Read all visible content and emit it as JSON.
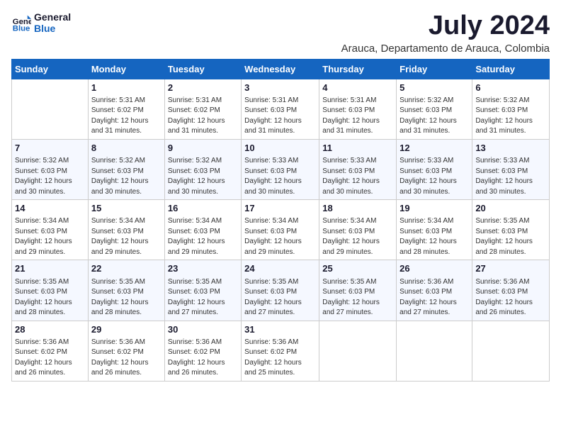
{
  "header": {
    "logo_line1": "General",
    "logo_line2": "Blue",
    "month_year": "July 2024",
    "location": "Arauca, Departamento de Arauca, Colombia"
  },
  "days_of_week": [
    "Sunday",
    "Monday",
    "Tuesday",
    "Wednesday",
    "Thursday",
    "Friday",
    "Saturday"
  ],
  "weeks": [
    [
      {
        "day": "",
        "info": ""
      },
      {
        "day": "1",
        "info": "Sunrise: 5:31 AM\nSunset: 6:02 PM\nDaylight: 12 hours\nand 31 minutes."
      },
      {
        "day": "2",
        "info": "Sunrise: 5:31 AM\nSunset: 6:02 PM\nDaylight: 12 hours\nand 31 minutes."
      },
      {
        "day": "3",
        "info": "Sunrise: 5:31 AM\nSunset: 6:03 PM\nDaylight: 12 hours\nand 31 minutes."
      },
      {
        "day": "4",
        "info": "Sunrise: 5:31 AM\nSunset: 6:03 PM\nDaylight: 12 hours\nand 31 minutes."
      },
      {
        "day": "5",
        "info": "Sunrise: 5:32 AM\nSunset: 6:03 PM\nDaylight: 12 hours\nand 31 minutes."
      },
      {
        "day": "6",
        "info": "Sunrise: 5:32 AM\nSunset: 6:03 PM\nDaylight: 12 hours\nand 31 minutes."
      }
    ],
    [
      {
        "day": "7",
        "info": "Sunrise: 5:32 AM\nSunset: 6:03 PM\nDaylight: 12 hours\nand 30 minutes."
      },
      {
        "day": "8",
        "info": "Sunrise: 5:32 AM\nSunset: 6:03 PM\nDaylight: 12 hours\nand 30 minutes."
      },
      {
        "day": "9",
        "info": "Sunrise: 5:32 AM\nSunset: 6:03 PM\nDaylight: 12 hours\nand 30 minutes."
      },
      {
        "day": "10",
        "info": "Sunrise: 5:33 AM\nSunset: 6:03 PM\nDaylight: 12 hours\nand 30 minutes."
      },
      {
        "day": "11",
        "info": "Sunrise: 5:33 AM\nSunset: 6:03 PM\nDaylight: 12 hours\nand 30 minutes."
      },
      {
        "day": "12",
        "info": "Sunrise: 5:33 AM\nSunset: 6:03 PM\nDaylight: 12 hours\nand 30 minutes."
      },
      {
        "day": "13",
        "info": "Sunrise: 5:33 AM\nSunset: 6:03 PM\nDaylight: 12 hours\nand 30 minutes."
      }
    ],
    [
      {
        "day": "14",
        "info": "Sunrise: 5:34 AM\nSunset: 6:03 PM\nDaylight: 12 hours\nand 29 minutes."
      },
      {
        "day": "15",
        "info": "Sunrise: 5:34 AM\nSunset: 6:03 PM\nDaylight: 12 hours\nand 29 minutes."
      },
      {
        "day": "16",
        "info": "Sunrise: 5:34 AM\nSunset: 6:03 PM\nDaylight: 12 hours\nand 29 minutes."
      },
      {
        "day": "17",
        "info": "Sunrise: 5:34 AM\nSunset: 6:03 PM\nDaylight: 12 hours\nand 29 minutes."
      },
      {
        "day": "18",
        "info": "Sunrise: 5:34 AM\nSunset: 6:03 PM\nDaylight: 12 hours\nand 29 minutes."
      },
      {
        "day": "19",
        "info": "Sunrise: 5:34 AM\nSunset: 6:03 PM\nDaylight: 12 hours\nand 28 minutes."
      },
      {
        "day": "20",
        "info": "Sunrise: 5:35 AM\nSunset: 6:03 PM\nDaylight: 12 hours\nand 28 minutes."
      }
    ],
    [
      {
        "day": "21",
        "info": "Sunrise: 5:35 AM\nSunset: 6:03 PM\nDaylight: 12 hours\nand 28 minutes."
      },
      {
        "day": "22",
        "info": "Sunrise: 5:35 AM\nSunset: 6:03 PM\nDaylight: 12 hours\nand 28 minutes."
      },
      {
        "day": "23",
        "info": "Sunrise: 5:35 AM\nSunset: 6:03 PM\nDaylight: 12 hours\nand 27 minutes."
      },
      {
        "day": "24",
        "info": "Sunrise: 5:35 AM\nSunset: 6:03 PM\nDaylight: 12 hours\nand 27 minutes."
      },
      {
        "day": "25",
        "info": "Sunrise: 5:35 AM\nSunset: 6:03 PM\nDaylight: 12 hours\nand 27 minutes."
      },
      {
        "day": "26",
        "info": "Sunrise: 5:36 AM\nSunset: 6:03 PM\nDaylight: 12 hours\nand 27 minutes."
      },
      {
        "day": "27",
        "info": "Sunrise: 5:36 AM\nSunset: 6:03 PM\nDaylight: 12 hours\nand 26 minutes."
      }
    ],
    [
      {
        "day": "28",
        "info": "Sunrise: 5:36 AM\nSunset: 6:02 PM\nDaylight: 12 hours\nand 26 minutes."
      },
      {
        "day": "29",
        "info": "Sunrise: 5:36 AM\nSunset: 6:02 PM\nDaylight: 12 hours\nand 26 minutes."
      },
      {
        "day": "30",
        "info": "Sunrise: 5:36 AM\nSunset: 6:02 PM\nDaylight: 12 hours\nand 26 minutes."
      },
      {
        "day": "31",
        "info": "Sunrise: 5:36 AM\nSunset: 6:02 PM\nDaylight: 12 hours\nand 25 minutes."
      },
      {
        "day": "",
        "info": ""
      },
      {
        "day": "",
        "info": ""
      },
      {
        "day": "",
        "info": ""
      }
    ]
  ]
}
